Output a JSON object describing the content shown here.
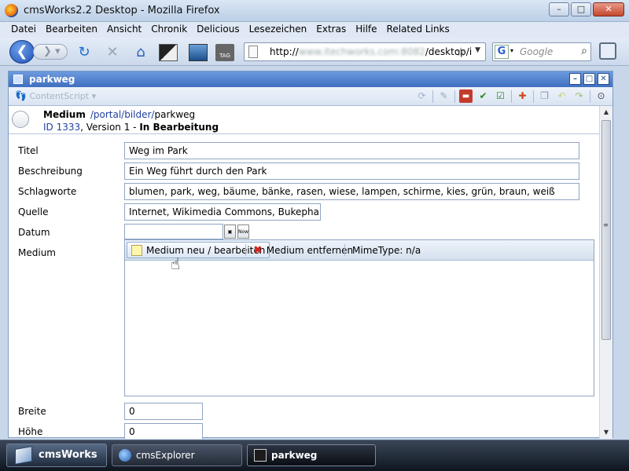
{
  "browser": {
    "title": "cmsWorks2.2 Desktop - Mozilla Firefox",
    "menu": [
      "Datei",
      "Bearbeiten",
      "Ansicht",
      "Chronik",
      "Delicious",
      "Lesezeichen",
      "Extras",
      "Hilfe",
      "Related Links"
    ],
    "url_prefix": "http://",
    "url_blurred": "www.itechworks.com:8082",
    "url_suffix": "/desktop/i",
    "search_placeholder": "Google",
    "search_engine": "G"
  },
  "panel": {
    "title": "parkweg",
    "content_script_label": "ContentScript"
  },
  "doc": {
    "type_label": "Medium",
    "path_link": "/portal/bilder/",
    "path_leaf": "parkweg",
    "id_label": "ID 1333",
    "version": ", Version 1",
    "separator": " - ",
    "status": "In Bearbeitung"
  },
  "fields": {
    "titel_label": "Titel",
    "titel_value": "Weg im Park",
    "beschreibung_label": "Beschreibung",
    "beschreibung_value": "Ein Weg führt durch den Park",
    "schlagworte_label": "Schlagworte",
    "schlagworte_value": "blumen, park, weg, bäume, bänke, rasen, wiese, lampen, schirme, kies, grün, braun, weiß",
    "quelle_label": "Quelle",
    "quelle_value": "Internet, Wikimedia Commons, Bukephalos",
    "datum_label": "Datum",
    "datum_value": "",
    "now_label": "Now",
    "medium_label": "Medium",
    "breite_label": "Breite",
    "breite_value": "0",
    "hoehe_label": "Höhe",
    "hoehe_value": "0"
  },
  "media": {
    "new_label": "Medium neu / bearbeiten",
    "remove_label": "Medium entfernen",
    "mimetype_label": "MimeType: n/a"
  },
  "taskbar": {
    "start_label": "cmsWorks",
    "tasks": [
      "cmsExplorer",
      "parkweg"
    ]
  }
}
